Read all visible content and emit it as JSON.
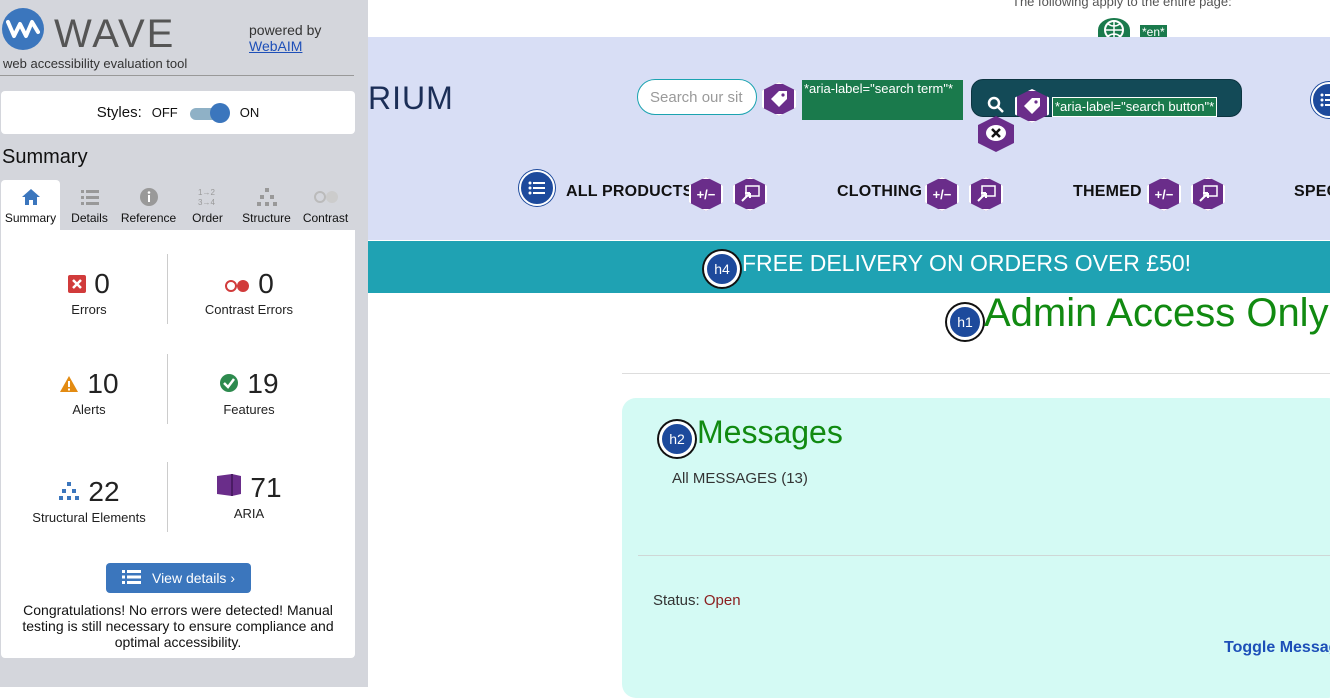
{
  "wave": {
    "logo_text": "WAVE",
    "tagline": "web accessibility evaluation tool",
    "powered_by": "powered by",
    "webaim_link": "WebAIM",
    "styles_label": "Styles:",
    "styles_off": "OFF",
    "styles_on": "ON",
    "summary_heading": "Summary",
    "tabs": [
      {
        "label": "Summary",
        "icon": "home-icon"
      },
      {
        "label": "Details",
        "icon": "list-icon"
      },
      {
        "label": "Reference",
        "icon": "info-icon"
      },
      {
        "label": "Order",
        "icon": "order-icon"
      },
      {
        "label": "Structure",
        "icon": "structure-icon"
      },
      {
        "label": "Contrast",
        "icon": "contrast-icon"
      }
    ],
    "stats": {
      "errors": {
        "count": "0",
        "label": "Errors"
      },
      "contrast_errors": {
        "count": "0",
        "label": "Contrast Errors"
      },
      "alerts": {
        "count": "10",
        "label": "Alerts"
      },
      "features": {
        "count": "19",
        "label": "Features"
      },
      "structural": {
        "count": "22",
        "label": "Structural Elements"
      },
      "aria": {
        "count": "71",
        "label": "ARIA"
      }
    },
    "view_details": "View details ›",
    "congrats": "Congratulations! No errors were detected! Manual testing is still necessary to ensure compliance and optimal accessibility."
  },
  "page": {
    "top_note": "The following apply to the entire page:",
    "lang_label": "*en*",
    "brand_partial": "RIUM",
    "search_placeholder": "Search our sit",
    "aria_search_term": "*aria-label=\"search term\"*",
    "aria_search_button": "*aria-label=\"search button\"*",
    "nav": [
      "ALL PRODUCTS",
      "CLOTHING",
      "THEMED",
      "SPEC"
    ],
    "delivery": "FREE DELIVERY ON ORDERS OVER £50!",
    "h4": "h4",
    "h1": "h1",
    "h2": "h2",
    "admin_title": "Admin Access Only",
    "messages_title": "Messages",
    "messages_sub": "All  MESSAGES (13)",
    "status_label": "Status:",
    "status_value": "Open",
    "toggle_message": "Toggle Message"
  },
  "colors": {
    "wave_blue": "#3b76bd",
    "header_band": "#d8def5",
    "delivery_band": "#1fa2b3",
    "heading_green": "#118a11",
    "aria_purple": "#6a2d8a",
    "card_bg": "#d4faf4"
  }
}
